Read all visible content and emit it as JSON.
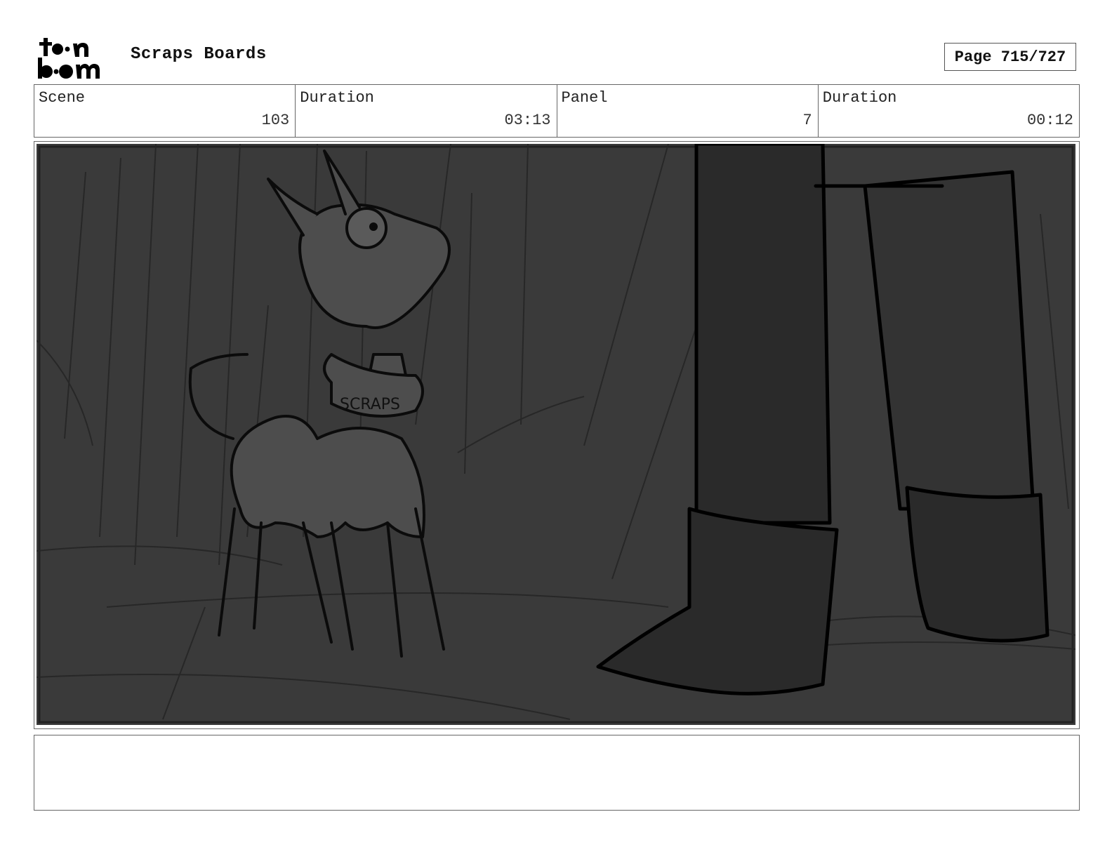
{
  "header": {
    "logo_text": "toon boom",
    "title": "Scraps Boards",
    "page_label": "Page 715/727"
  },
  "info": {
    "scene_label": "Scene",
    "scene_value": "103",
    "scene_duration_label": "Duration",
    "scene_duration_value": "03:13",
    "panel_label": "Panel",
    "panel_value": "7",
    "panel_duration_label": "Duration",
    "panel_duration_value": "00:12"
  },
  "panel": {
    "collar_text": "SCRAPS"
  },
  "notes": {
    "text": ""
  }
}
